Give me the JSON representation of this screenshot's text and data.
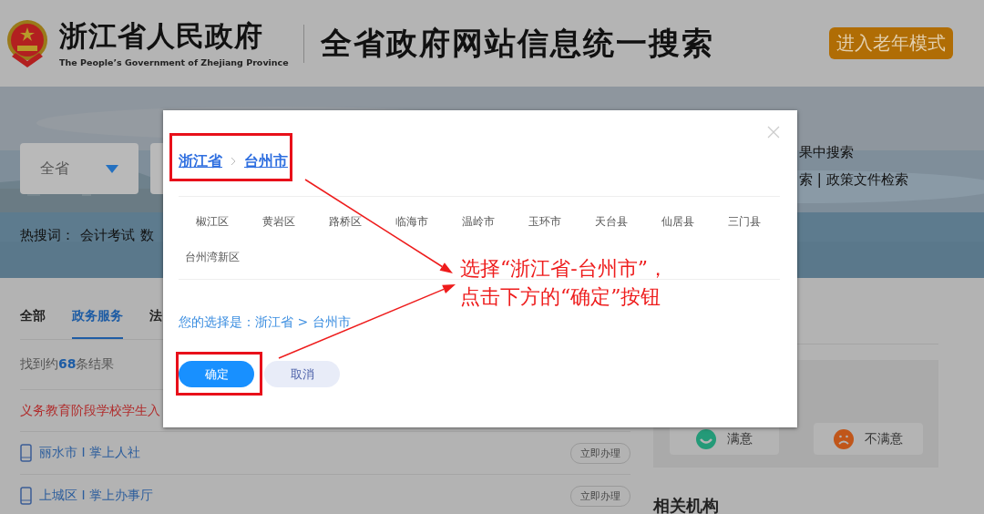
{
  "header": {
    "title": "浙江省人民政府",
    "subtitle": "The People’s Government of Zhejiang Province",
    "site_name": "全省政府网站信息统一搜索",
    "elder_mode_button": "进入老年模式"
  },
  "search": {
    "scope": "全省",
    "link": "果中搜索",
    "advanced_links": "索 | 政策文件检索",
    "hot_words_label": "热搜词：",
    "hot_words": [
      "会计考试",
      "数"
    ]
  },
  "tabs": [
    {
      "label": "全部",
      "selected": false
    },
    {
      "label": "政务服务",
      "selected": true
    },
    {
      "label": "法",
      "selected": false
    }
  ],
  "result_count": "找到约**68**条结果",
  "notice": "义务教育阶段学校学生入",
  "results": [
    {
      "title": "丽水市 I 掌上人社",
      "action": "立即办理"
    },
    {
      "title": "上城区 I 掌上办事厅",
      "action": "立即办理"
    }
  ],
  "feedback": [
    {
      "label": "满意",
      "kind": "satisfied"
    },
    {
      "label": "不满意",
      "kind": "dissatisfied"
    }
  ],
  "related_heading": "相关机构",
  "dialog": {
    "breadcrumb": [
      "浙江省",
      "台州市"
    ],
    "districts": [
      "椒江区",
      "黄岩区",
      "路桥区",
      "临海市",
      "温岭市",
      "玉环市",
      "天台县",
      "仙居县",
      "三门县",
      "台州湾新区"
    ],
    "selection_label": "您的选择是：",
    "selection_value": "浙江省 > 台州市",
    "confirm": "确定",
    "cancel": "取消"
  },
  "annotation": [
    "选择“浙江省-台州市”，",
    "点击下方的“确定”按钮"
  ]
}
